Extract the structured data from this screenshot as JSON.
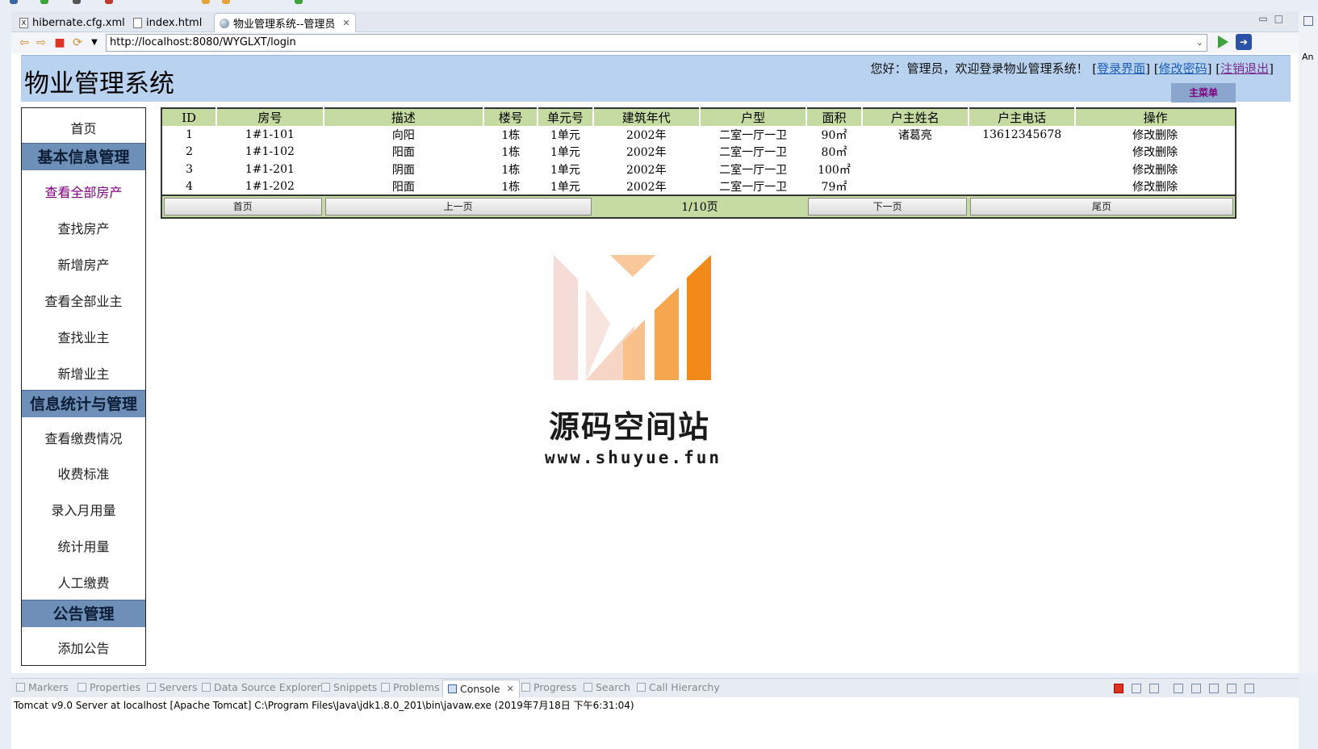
{
  "tabs": [
    {
      "label": "hibernate.cfg.xml",
      "icon": "xml-file-icon"
    },
    {
      "label": "index.html",
      "icon": "html-file-icon"
    },
    {
      "label": "物业管理系统--管理员",
      "icon": "browser-globe-icon"
    }
  ],
  "address": {
    "url": "http://localhost:8080/WYGLXT/login"
  },
  "header": {
    "title": "物业管理系统",
    "greeting": "您好：管理员，欢迎登录物业管理系统！",
    "links": [
      "登录界面",
      "修改密码",
      "注销退出"
    ],
    "main_menu": "主菜单"
  },
  "sidebar": {
    "home": "首页",
    "groups": [
      {
        "title": "基本信息管理",
        "items": [
          "查看全部房产",
          "查找房产",
          "新增房产",
          "查看全部业主",
          "查找业主",
          "新增业主"
        ]
      },
      {
        "title": "信息统计与管理",
        "items": [
          "查看缴费情况",
          "收费标准",
          "录入月用量",
          "统计用量",
          "人工缴费"
        ]
      },
      {
        "title": "公告管理",
        "items": [
          "添加公告"
        ]
      }
    ],
    "current": "查看全部房产"
  },
  "table": {
    "columns": [
      "ID",
      "房号",
      "描述",
      "楼号",
      "单元号",
      "建筑年代",
      "户型",
      "面积",
      "户主姓名",
      "户主电话",
      "操作"
    ],
    "rows": [
      [
        "1",
        "1#1-101",
        "向阳",
        "1栋",
        "1单元",
        "2002年",
        "二室一厅一卫",
        "90㎡",
        "诸葛亮",
        "13612345678",
        "修改删除"
      ],
      [
        "2",
        "1#1-102",
        "阳面",
        "1栋",
        "1单元",
        "2002年",
        "二室一厅一卫",
        "80㎡",
        "",
        "",
        "修改删除"
      ],
      [
        "3",
        "1#1-201",
        "阴面",
        "1栋",
        "1单元",
        "2002年",
        "二室一厅一卫",
        "100㎡",
        "",
        "",
        "修改删除"
      ],
      [
        "4",
        "1#1-202",
        "阳面",
        "1栋",
        "1单元",
        "2002年",
        "二室一厅一卫",
        "79㎡",
        "",
        "",
        "修改删除"
      ]
    ],
    "pager": {
      "first": "首页",
      "prev": "上一页",
      "info": "1/10页",
      "next": "下一页",
      "last": "尾页"
    }
  },
  "watermark": {
    "title": "源码空间站",
    "url": "www.shuyue.fun"
  },
  "console": {
    "tabs": [
      "Markers",
      "Properties",
      "Servers",
      "Data Source Explorer",
      "Snippets",
      "Problems",
      "Console",
      "Progress",
      "Search",
      "Call Hierarchy"
    ],
    "active_tab": "Console",
    "info": "Tomcat v9.0 Server at localhost [Apache Tomcat] C:\\Program Files\\Java\\jdk1.8.0_201\\bin\\javaw.exe (2019年7月18日 下午6:31:04)"
  },
  "side_panel_label": "An",
  "colors": {
    "header_bg": "#b9d2ef",
    "table_header_bg": "#c5dba1",
    "sidebar_group_bg": "#6d8fb8",
    "visited_link": "#800080",
    "watermark_orange": "#f28a1a"
  }
}
